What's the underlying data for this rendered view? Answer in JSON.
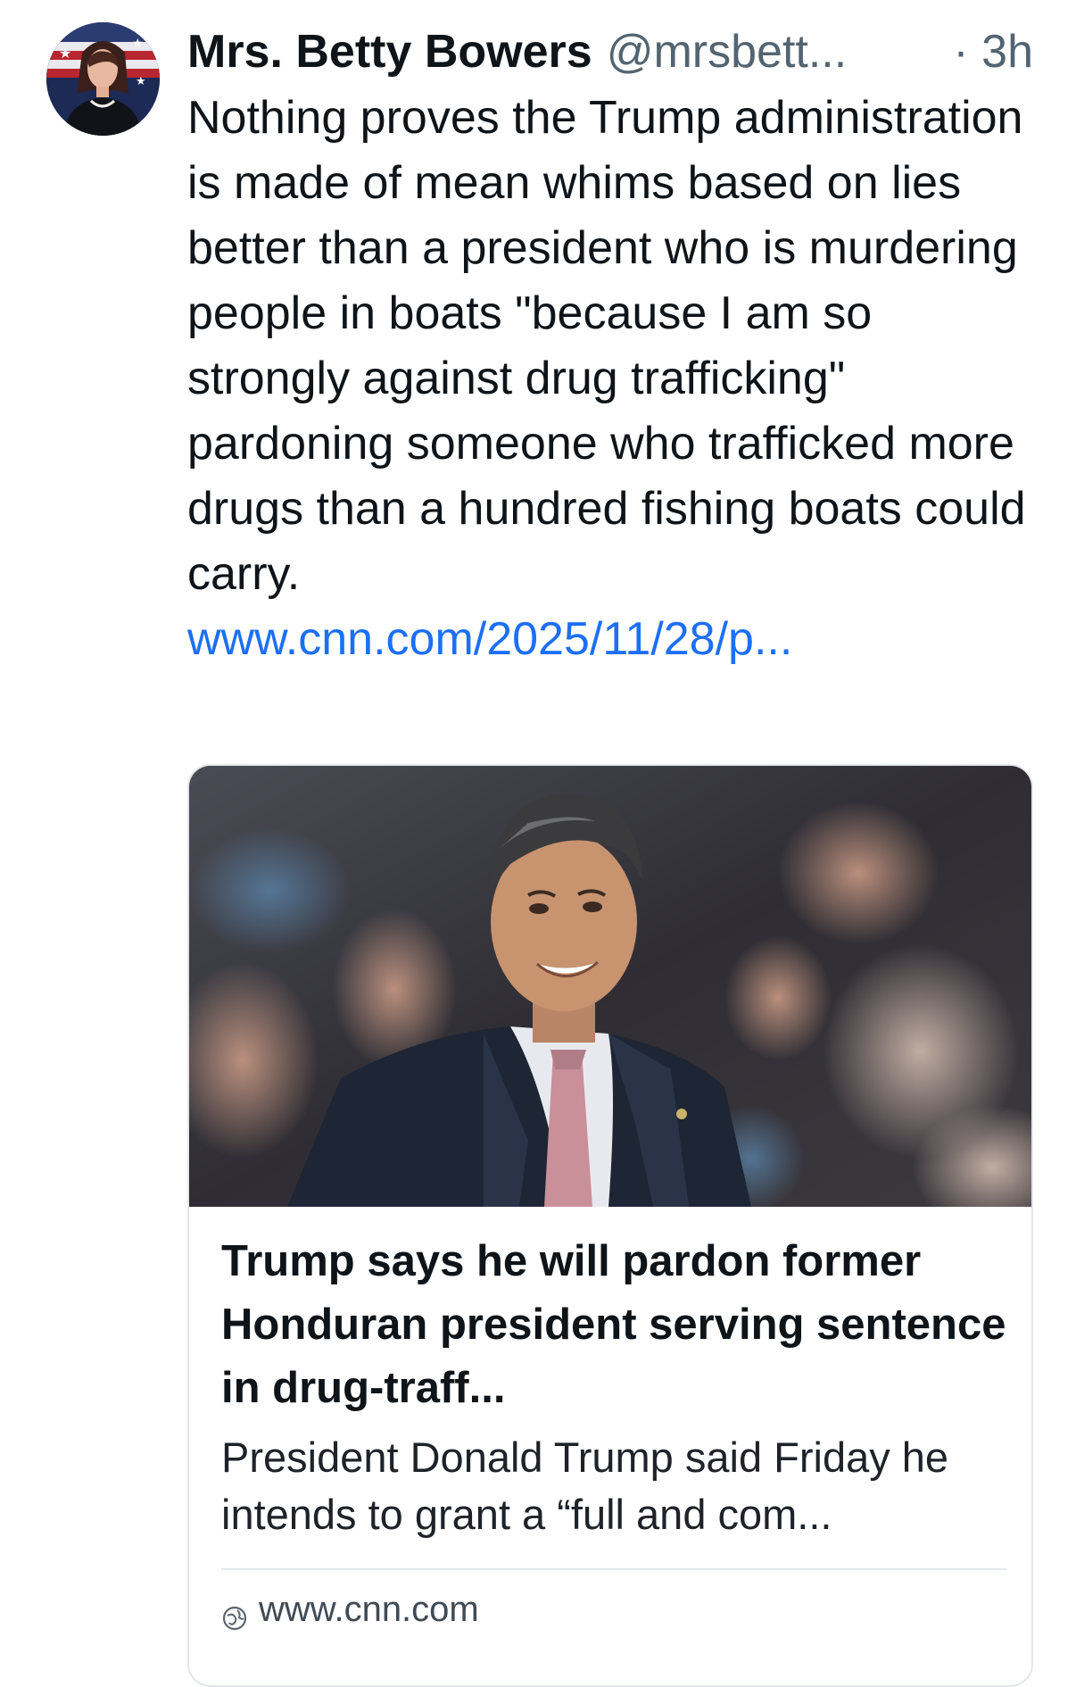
{
  "post": {
    "author": {
      "display_name": "Mrs. Betty Bowers",
      "handle": "@mrsbett...",
      "avatar_icon": "avatar-photo"
    },
    "time_label": "· 3h",
    "body_text": "Nothing proves the Trump administration is made of mean whims based on lies better than a president who is murdering people in boats \"because I am so strongly against drug trafficking\" pardoning someone who trafficked more drugs than a hundred fishing boats could carry.",
    "link_text": "www.cnn.com/2025/11/28/p...",
    "link_color": "#1d6ff5"
  },
  "link_card": {
    "image_icon": "article-photo",
    "title": "Trump says he will pardon former Honduran president serving sentence in drug-traff...",
    "description": "President Donald Trump said Friday he intends to grant a “full and com...",
    "domain": "www.cnn.com",
    "domain_icon": "globe-icon"
  },
  "colors": {
    "text_primary": "#0f1419",
    "text_secondary": "#536471",
    "border": "#e3e6ea"
  }
}
